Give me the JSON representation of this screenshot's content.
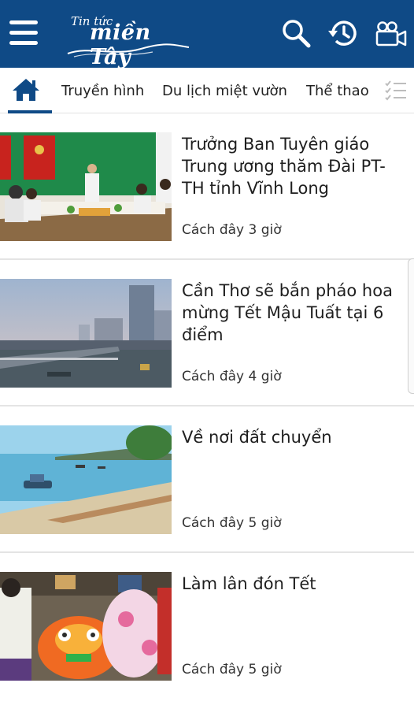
{
  "header": {
    "logo_small": "Tin tức",
    "logo_big": "miền Tây",
    "background_color": "#0f4a86",
    "icons": [
      "menu-icon",
      "search-icon",
      "history-icon",
      "video-camera-icon"
    ]
  },
  "tabs": [
    {
      "label": "Truyền hình"
    },
    {
      "label": "Du lịch miệt vườn"
    },
    {
      "label": "Thể thao"
    }
  ],
  "articles": [
    {
      "title": "Trưởng Ban Tuyên giáo Trung ương thăm Đài PT-TH tỉnh Vĩnh Long",
      "time": "Cách đây 3 giờ"
    },
    {
      "title": "Cần Thơ sẽ bắn pháo hoa mừng Tết Mậu Tuất tại 6 điểm",
      "time": "Cách đây 4 giờ"
    },
    {
      "title": "Về nơi đất chuyển",
      "time": "Cách đây 5 giờ"
    },
    {
      "title": "Làm lân đón Tết",
      "time": "Cách đây 5 giờ"
    }
  ]
}
